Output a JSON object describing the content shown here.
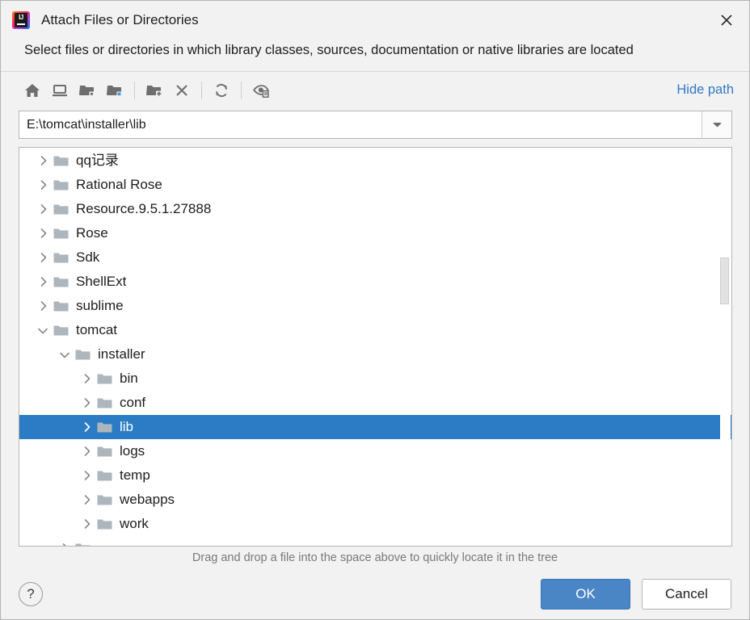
{
  "window": {
    "title": "Attach Files or Directories",
    "logo_icon": "intellij-idea-logo",
    "close_icon": "close-icon"
  },
  "subtitle": "Select files or directories in which library classes, sources, documentation or native libraries are located",
  "toolbar": {
    "buttons": [
      {
        "name": "home-icon",
        "tooltip": "Home"
      },
      {
        "name": "desktop-icon",
        "tooltip": "Desktop"
      },
      {
        "name": "project-folder-icon",
        "tooltip": "Project"
      },
      {
        "name": "module-folder-icon",
        "tooltip": "Module"
      },
      {
        "name": "new-folder-icon",
        "tooltip": "New Folder"
      },
      {
        "name": "delete-icon",
        "tooltip": "Delete"
      },
      {
        "name": "refresh-icon",
        "tooltip": "Refresh"
      },
      {
        "name": "show-hidden-files-icon",
        "tooltip": "Show Hidden Files"
      }
    ],
    "hide_path_label": "Hide path"
  },
  "path_field": {
    "value": "E:\\tomcat\\installer\\lib",
    "placeholder": "",
    "dropdown_icon": "chevron-down-icon"
  },
  "tree": {
    "rows": [
      {
        "label": "qq记录",
        "depth": 1,
        "state": "collapsed",
        "selected": false
      },
      {
        "label": "Rational Rose",
        "depth": 1,
        "state": "collapsed",
        "selected": false
      },
      {
        "label": "Resource.9.5.1.27888",
        "depth": 1,
        "state": "collapsed",
        "selected": false
      },
      {
        "label": "Rose",
        "depth": 1,
        "state": "collapsed",
        "selected": false
      },
      {
        "label": "Sdk",
        "depth": 1,
        "state": "collapsed",
        "selected": false
      },
      {
        "label": "ShellExt",
        "depth": 1,
        "state": "collapsed",
        "selected": false
      },
      {
        "label": "sublime",
        "depth": 1,
        "state": "collapsed",
        "selected": false
      },
      {
        "label": "tomcat",
        "depth": 1,
        "state": "expanded",
        "selected": false
      },
      {
        "label": "installer",
        "depth": 2,
        "state": "expanded",
        "selected": false
      },
      {
        "label": "bin",
        "depth": 3,
        "state": "collapsed",
        "selected": false
      },
      {
        "label": "conf",
        "depth": 3,
        "state": "collapsed",
        "selected": false
      },
      {
        "label": "lib",
        "depth": 3,
        "state": "collapsed",
        "selected": true
      },
      {
        "label": "logs",
        "depth": 3,
        "state": "collapsed",
        "selected": false
      },
      {
        "label": "temp",
        "depth": 3,
        "state": "collapsed",
        "selected": false
      },
      {
        "label": "webapps",
        "depth": 3,
        "state": "collapsed",
        "selected": false
      },
      {
        "label": "work",
        "depth": 3,
        "state": "collapsed",
        "selected": false
      },
      {
        "label": "",
        "depth": 2,
        "state": "collapsed",
        "selected": false
      }
    ]
  },
  "hint": "Drag and drop a file into the space above to quickly locate it in the tree",
  "footer": {
    "help_label": "?",
    "ok_label": "OK",
    "cancel_label": "Cancel"
  },
  "colors": {
    "selection": "#2b7cc4",
    "accent_link": "#2f79c4",
    "ok_button": "#4a86c5",
    "dialog_bg": "#f2f2f2",
    "folder": "#adb6bd"
  }
}
